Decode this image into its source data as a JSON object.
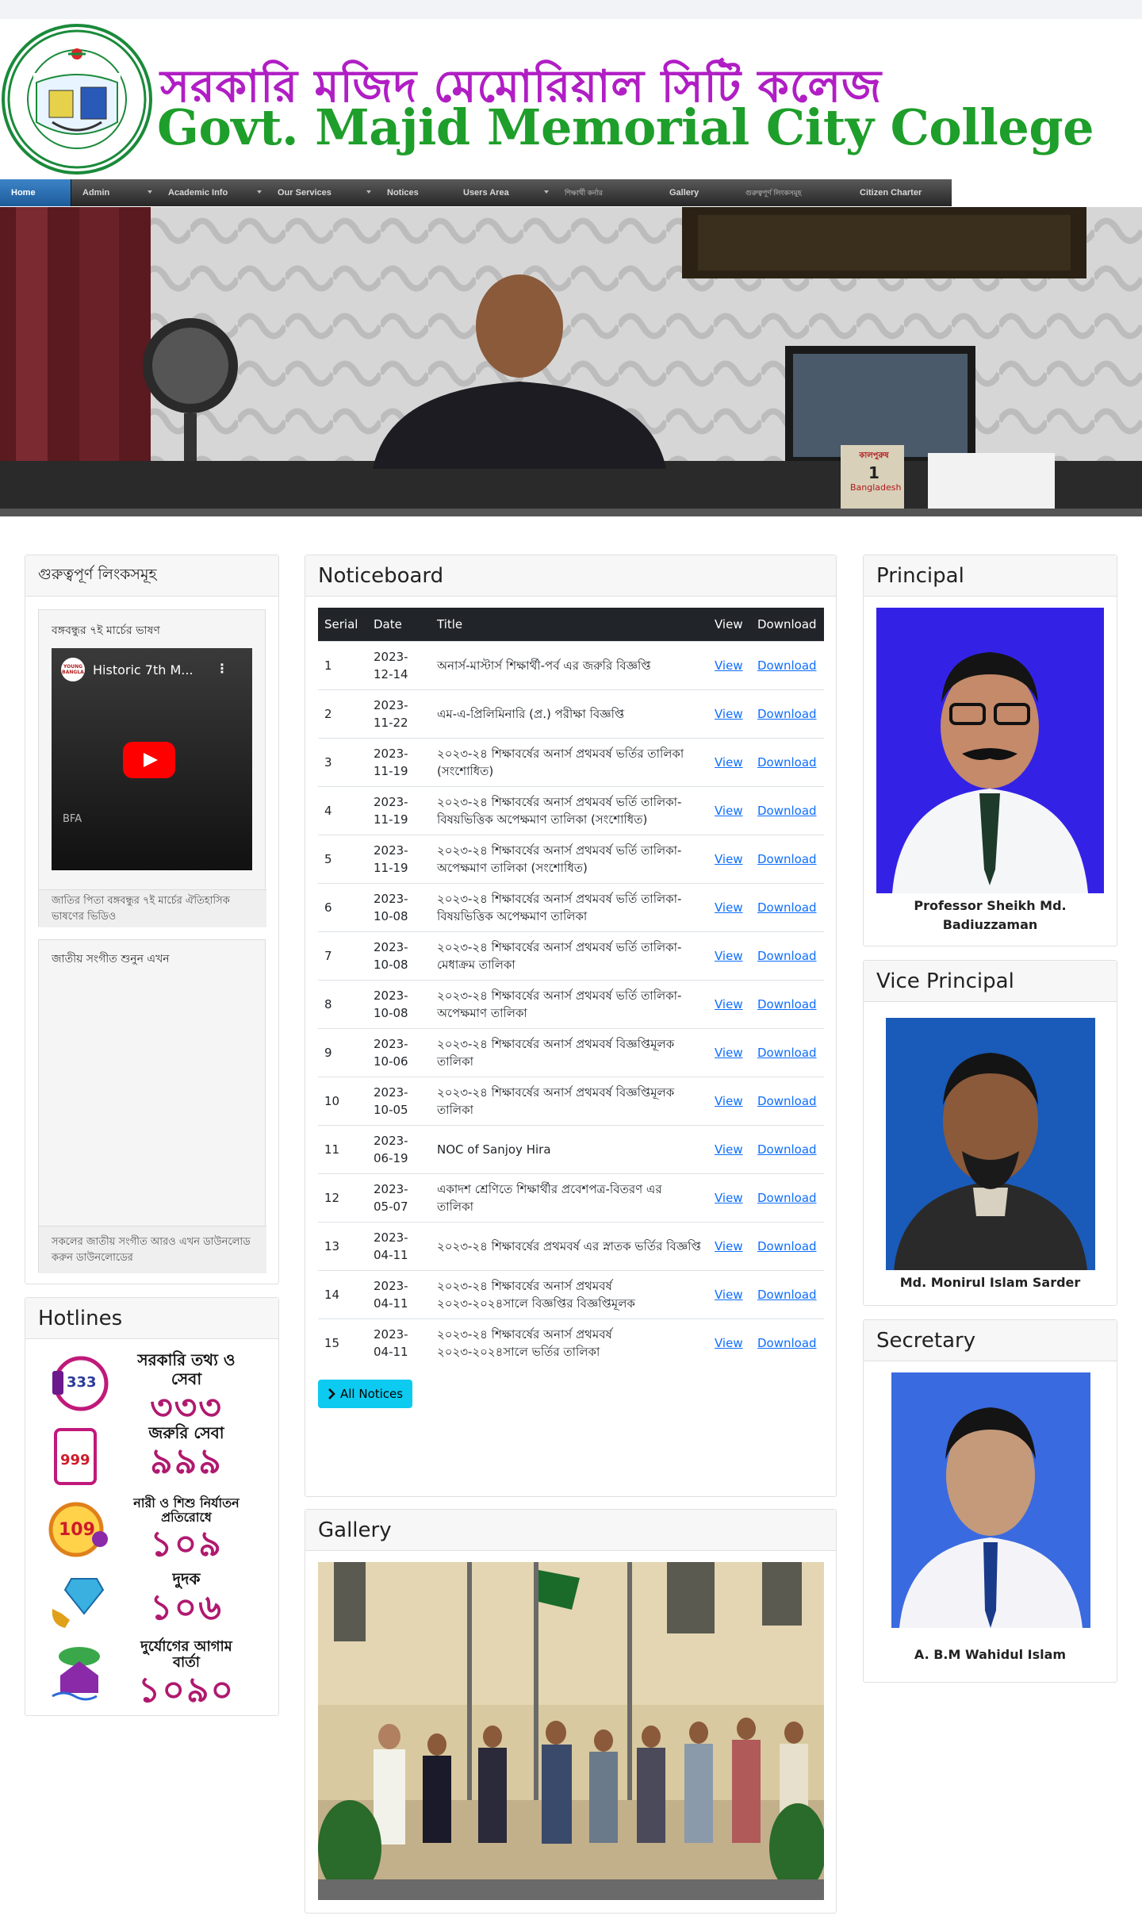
{
  "header": {
    "title_bn": "সরকারি মজিদ মেমোরিয়াল সিটি কলেজ",
    "title_en": "Govt. Majid Memorial City College"
  },
  "nav": {
    "items": [
      {
        "label": "Home",
        "active": true,
        "caret": false
      },
      {
        "label": "Admin",
        "active": false,
        "caret": true
      },
      {
        "label": "Academic Info",
        "active": false,
        "caret": true
      },
      {
        "label": "Our Services",
        "active": false,
        "caret": true
      },
      {
        "label": "Notices",
        "active": false,
        "caret": false
      },
      {
        "label": "Users Area",
        "active": false,
        "caret": true
      },
      {
        "label": "শিক্ষার্থী কর্নার",
        "active": false,
        "caret": false
      },
      {
        "label": "Gallery",
        "active": false,
        "caret": false
      },
      {
        "label": "গুরুত্বপূর্ণ লিংকসমূহ",
        "active": false,
        "caret": false
      },
      {
        "label": "Citizen Charter",
        "active": false,
        "caret": false
      }
    ]
  },
  "left": {
    "box_title": "গুরুত্বপূর্ণ লিংকসমূহ",
    "video_caption": "বঙ্গবন্ধুর ৭ই মার্চের ভাষণ",
    "video_title": "Historic 7th M...",
    "video_channel_badge": "YOUNG BANGLA",
    "video_watermark": "BFA",
    "video_footer": "জাতির পিতা বঙ্গবন্ধুর ৭ই মার্চের ঐতিহাসিক ভাষণের ভিডিও",
    "second_caption": "জাতীয় সংগীত শুনুন এখন",
    "second_footer": "সকলের জাতীয় সংগীত আরও এখন ডাউনলোড করুন ডাউনলোডের",
    "hotlines_title": "Hotlines",
    "hotlines": [
      {
        "title": "সরকারি তথ্য ও সেবা",
        "number": "৩৩৩",
        "icon": "phone-333-icon",
        "badge": "333"
      },
      {
        "title": "জরুরি সেবা",
        "number": "৯৯৯",
        "icon": "emergency-999-icon",
        "badge": "999"
      },
      {
        "title": "নারী ও শিশু নির্যাতন প্রতিরোধে",
        "number": "১০৯",
        "icon": "women-child-109-icon",
        "badge": "109"
      },
      {
        "title": "দুদক",
        "number": "১০৬",
        "icon": "acc-106-icon",
        "badge": "106"
      },
      {
        "title": "দুর্যোগের আগাম বার্তা",
        "number": "১০৯০",
        "icon": "disaster-1090-icon",
        "badge": "1090"
      }
    ]
  },
  "noticeboard": {
    "title": "Noticeboard",
    "columns": [
      "Serial",
      "Date",
      "Title",
      "View",
      "Download"
    ],
    "view_label": "View",
    "download_label": "Download",
    "rows": [
      {
        "serial": "1",
        "date": "2023-12-14",
        "title": "অনার্স-মাস্টার্স শিক্ষার্থী-পর্ব এর জরুরি বিজ্ঞপ্তি"
      },
      {
        "serial": "2",
        "date": "2023-11-22",
        "title": "এম-এ-প্রিলিমিনারি (প্র.) পরীক্ষা বিজ্ঞপ্তি"
      },
      {
        "serial": "3",
        "date": "2023-11-19",
        "title": "২০২৩-২৪ শিক্ষাবর্ষের অনার্স প্রথমবর্ষ ভর্তির তালিকা (সংশোধিত)"
      },
      {
        "serial": "4",
        "date": "2023-11-19",
        "title": "২০২৩-২৪ শিক্ষাবর্ষের অনার্স প্রথমবর্ষ ভর্তি তালিকা-বিষয়ভিত্তিক অপেক্ষমাণ তালিকা (সংশোধিত)"
      },
      {
        "serial": "5",
        "date": "2023-11-19",
        "title": "২০২৩-২৪ শিক্ষাবর্ষের অনার্স প্রথমবর্ষ ভর্তি তালিকা- অপেক্ষমাণ তালিকা (সংশোধিত)"
      },
      {
        "serial": "6",
        "date": "2023-10-08",
        "title": "২০২৩-২৪ শিক্ষাবর্ষের অনার্স প্রথমবর্ষ ভর্তি তালিকা-বিষয়ভিত্তিক অপেক্ষমাণ তালিকা"
      },
      {
        "serial": "7",
        "date": "2023-10-08",
        "title": "২০২৩-২৪ শিক্ষাবর্ষের অনার্স প্রথমবর্ষ ভর্তি তালিকা-মেধাক্রম তালিকা"
      },
      {
        "serial": "8",
        "date": "2023-10-08",
        "title": "২০২৩-২৪ শিক্ষাবর্ষের অনার্স প্রথমবর্ষ ভর্তি তালিকা- অপেক্ষমাণ তালিকা"
      },
      {
        "serial": "9",
        "date": "2023-10-06",
        "title": "২০২৩-২৪ শিক্ষাবর্ষের অনার্স প্রথমবর্ষ বিজ্ঞপ্তিমূলক তালিকা"
      },
      {
        "serial": "10",
        "date": "2023-10-05",
        "title": "২০২৩-২৪ শিক্ষাবর্ষের অনার্স প্রথমবর্ষ বিজ্ঞপ্তিমূলক তালিকা"
      },
      {
        "serial": "11",
        "date": "2023-06-19",
        "title": "NOC of Sanjoy Hira"
      },
      {
        "serial": "12",
        "date": "2023-05-07",
        "title": "একাদশ শ্রেণিতে শিক্ষার্থীর প্রবেশপত্র-বিতরণ এর তালিকা"
      },
      {
        "serial": "13",
        "date": "2023-04-11",
        "title": "২০২৩-২৪ শিক্ষাবর্ষের প্রথমবর্ষ এর স্নাতক ভর্তির বিজ্ঞপ্তি"
      },
      {
        "serial": "14",
        "date": "2023-04-11",
        "title": "২০২৩-২৪ শিক্ষাবর্ষের অনার্স প্রথমবর্ষ ২০২৩-২০২৪সালে বিজ্ঞপ্তির বিজ্ঞপ্তিমূলক"
      },
      {
        "serial": "15",
        "date": "2023-04-11",
        "title": "২০২৩-২৪ শিক্ষাবর্ষের অনার্স প্রথমবর্ষ ২০২৩-২০২৪সালে ভর্তির তালিকা"
      }
    ],
    "all_notices_label": "All Notices"
  },
  "gallery": {
    "title": "Gallery"
  },
  "right": {
    "principal": {
      "heading": "Principal",
      "name": "Professor Sheikh Md. Badiuzzaman"
    },
    "vice_principal": {
      "heading": "Vice Principal",
      "name": "Md. Monirul Islam Sarder"
    },
    "secretary": {
      "heading": "Secretary",
      "name": "A. B.M Wahidul Islam"
    }
  },
  "banner": {
    "calendar_day": "1",
    "calendar_month": "কালপুরুষ",
    "calendar_country": "Bangladesh"
  },
  "colors": {
    "brand_purple": "#b01ec4",
    "brand_green": "#1e9e2a",
    "link": "#0d6efd",
    "button_info": "#0dcaf0",
    "hotline_number": "#b0196f"
  }
}
